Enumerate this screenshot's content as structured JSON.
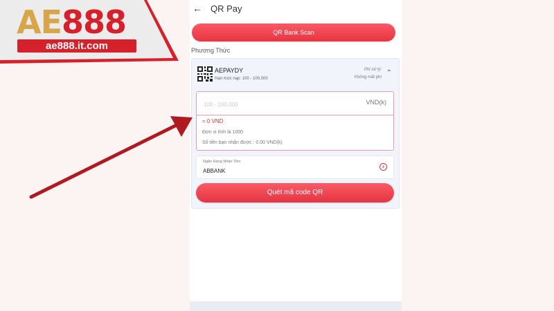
{
  "brand": {
    "logo_ae": "AE",
    "logo_888": "888",
    "url": "ae888.it.com",
    "colors": {
      "gold": "#d8a64a",
      "red": "#d6202a"
    }
  },
  "header": {
    "back_icon": "arrow-left-icon",
    "title": "QR Pay"
  },
  "scan_button": {
    "label": "QR Bank Scan"
  },
  "method_section": {
    "label": "Phương Thức"
  },
  "method": {
    "icon": "qr-code-icon",
    "name": "AEPAYDY",
    "range": "Hạn mức nạp: 100 - 100,000",
    "fee_label": "Phí xử lý:",
    "fee_value": "Không mất phí"
  },
  "amount": {
    "placeholder": "100 - 100,000",
    "value": "",
    "unit": "VND(k)",
    "converted": "= 0 VND",
    "unit_note": "Đơn vị tính là 1000",
    "received_note": "Số tiền bạn nhận được : 0.00 VND(k)"
  },
  "bank": {
    "label": "Ngân Hàng Nhận Tiền",
    "value": "ABBANK"
  },
  "qr_button": {
    "label": "Quét mã code QR"
  },
  "colors": {
    "accent": "#e83440",
    "annotation_arrow": "#b0191f"
  }
}
